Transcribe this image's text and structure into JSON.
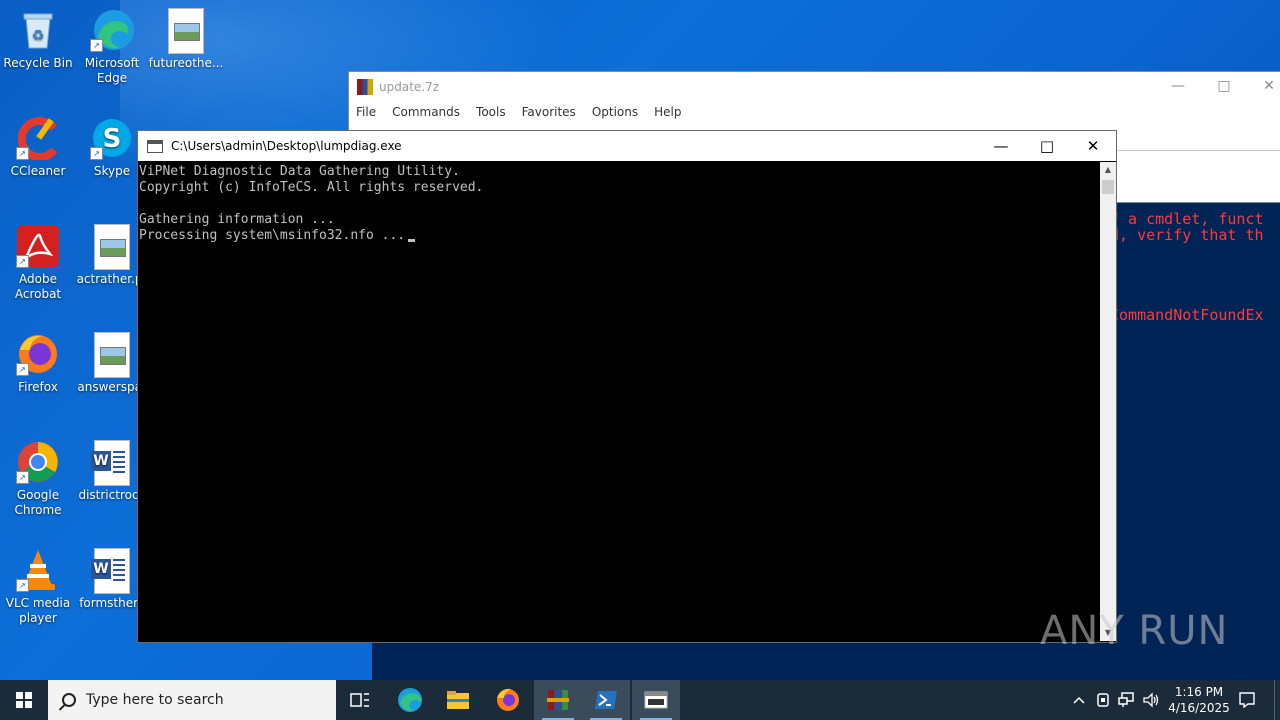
{
  "desktop": {
    "icons": [
      {
        "label": "Recycle Bin"
      },
      {
        "label": "Microsoft Edge"
      },
      {
        "label": "futureothe..."
      },
      {
        "label": "CCleaner"
      },
      {
        "label": "Skype"
      },
      {
        "label": "Adobe Acrobat"
      },
      {
        "label": "actrather.pr"
      },
      {
        "label": "Firefox"
      },
      {
        "label": "answerspat"
      },
      {
        "label": "Google Chrome"
      },
      {
        "label": "districtrock"
      },
      {
        "label": "VLC media player"
      },
      {
        "label": "formsthem"
      }
    ]
  },
  "winrar": {
    "title": "update.7z",
    "menu": [
      "File",
      "Commands",
      "Tools",
      "Favorites",
      "Options",
      "Help"
    ]
  },
  "powershell": {
    "lines": [
      "f a cmdlet, funct",
      "d, verify that th",
      "CommandNotFoundEx"
    ]
  },
  "console": {
    "title": "C:\\Users\\admin\\Desktop\\lumpdiag.exe",
    "lines": [
      "ViPNet Diagnostic Data Gathering Utility.",
      "Copyright (c) InfoTeCS. All rights reserved.",
      "",
      "Gathering information ...",
      "Processing system\\msinfo32.nfo ..."
    ]
  },
  "watermark": "ANY RUN",
  "taskbar": {
    "search_placeholder": "Type here to search",
    "time": "1:16 PM",
    "date": "4/16/2025"
  }
}
